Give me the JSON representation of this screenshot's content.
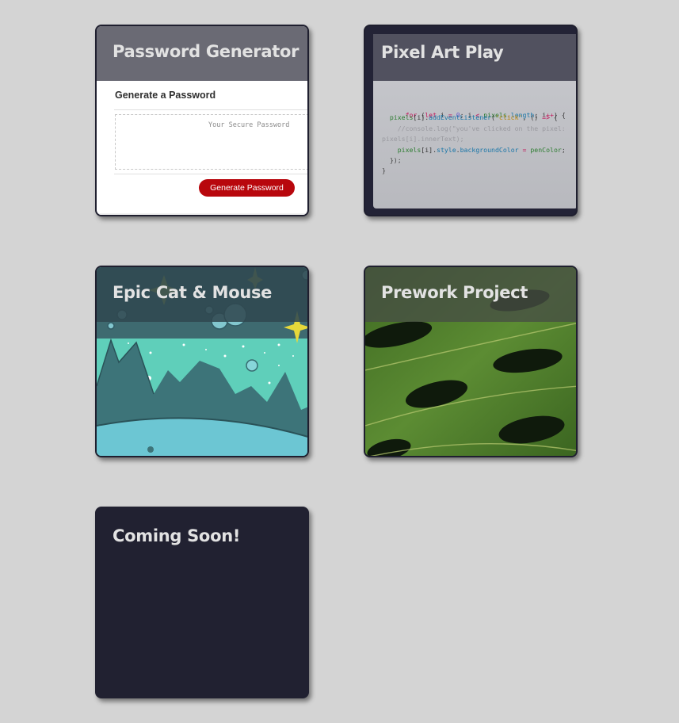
{
  "projects": [
    {
      "title": "Password Generator",
      "preview": {
        "heading": "Generate a Password",
        "placeholder": "Your Secure Password",
        "button_label": "Generate Password",
        "button_color": "#b8070d"
      }
    },
    {
      "title": "Pixel Art Play",
      "preview": {
        "code_lines": [
          "for (let i = 0; i < pixels.length; i++) {",
          "  pixels[i].addEventListener('click', () => {",
          "    //console.log(\"you've clicked on the pixel:",
          "pixels[i].innerText);",
          "    pixels[i].style.backgroundColor = penColor;",
          "  });",
          "}"
        ]
      }
    },
    {
      "title": "Epic Cat & Mouse",
      "preview": {
        "background_color": "#5fcfba"
      }
    },
    {
      "title": "Prework Project",
      "preview": {
        "background_color": "#4d7a2c"
      }
    },
    {
      "title": "Coming Soon!",
      "preview": {
        "background_color": "#212131"
      }
    }
  ],
  "colors": {
    "page_background": "#d4d4d4",
    "card_dark": "#212131",
    "title_text": "#e2e2e2"
  }
}
